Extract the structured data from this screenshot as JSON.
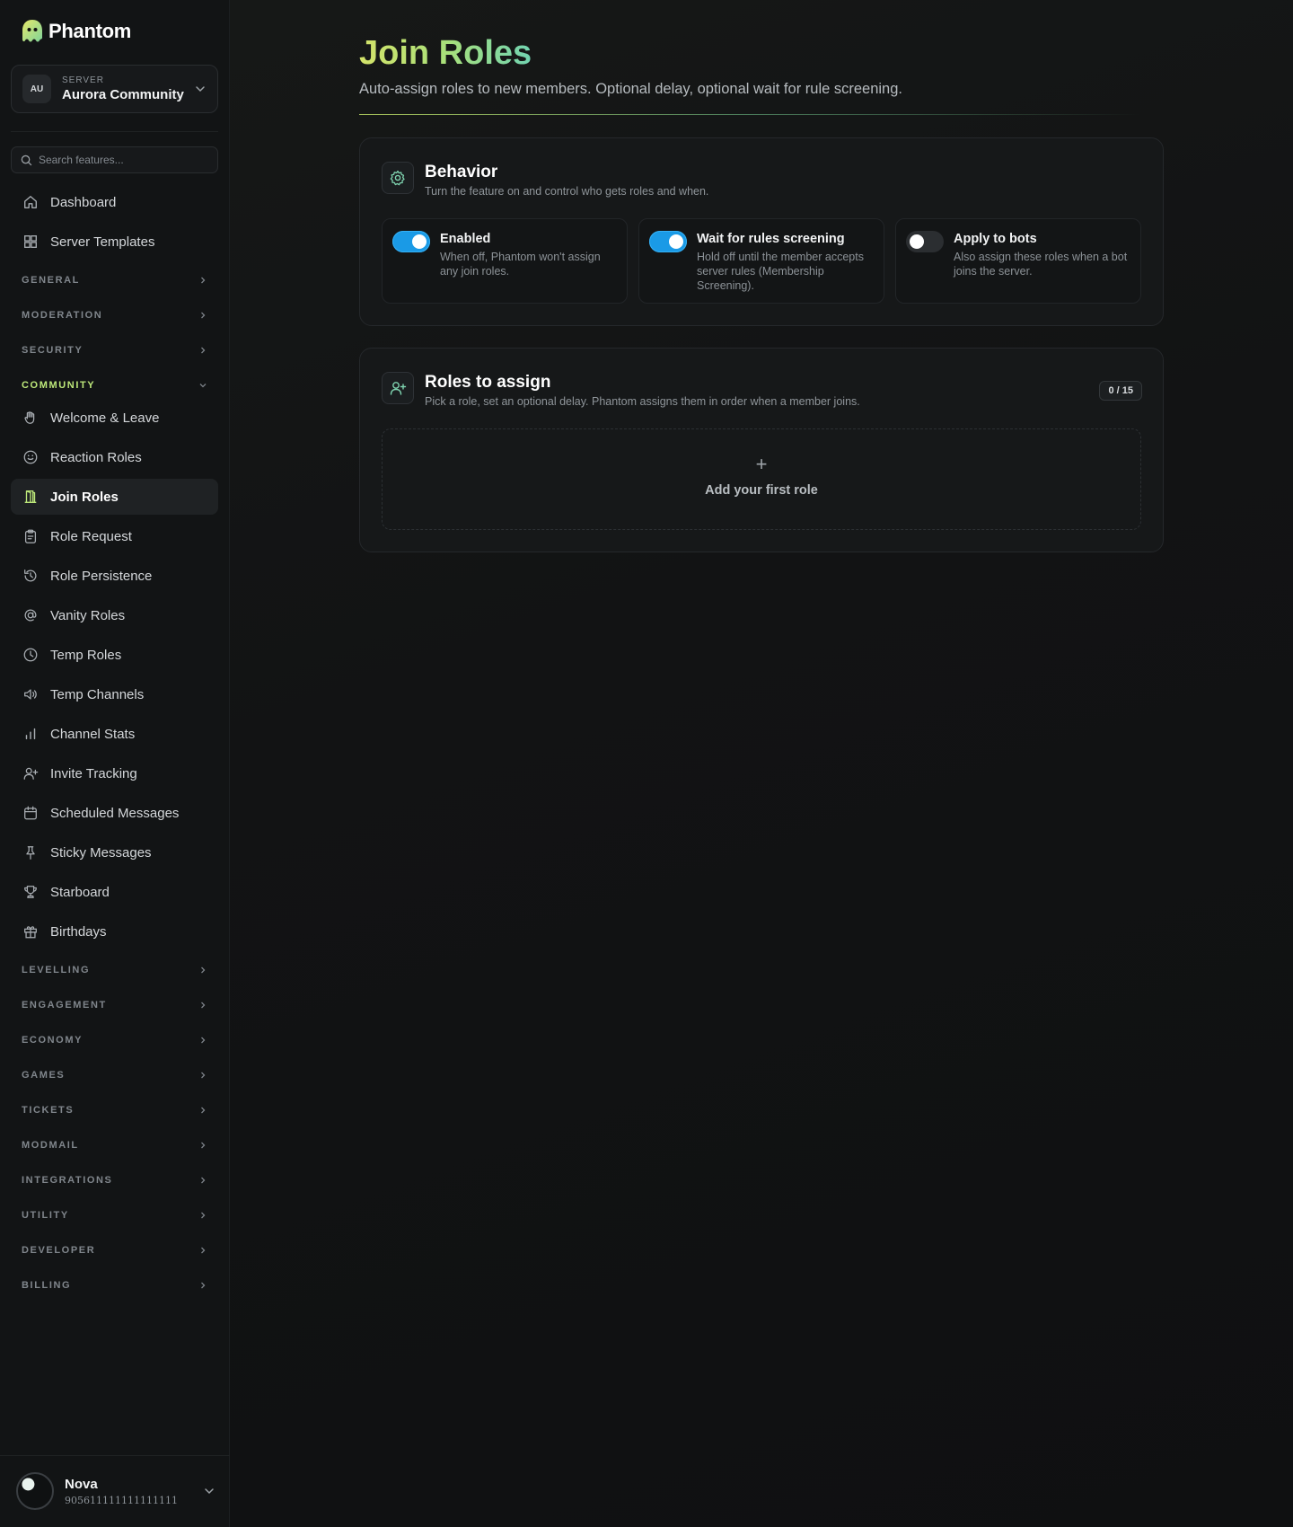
{
  "brand": {
    "name": "Phantom"
  },
  "server": {
    "avatar": "AU",
    "caption": "SERVER",
    "name": "Aurora Community"
  },
  "search": {
    "placeholder": "Search features..."
  },
  "nav_top": [
    {
      "label": "Dashboard",
      "icon": "home-icon"
    },
    {
      "label": "Server Templates",
      "icon": "grid-icon"
    }
  ],
  "sections": {
    "general": "GENERAL",
    "moderation": "MODERATION",
    "security": "SECURITY",
    "community": "COMMUNITY",
    "levelling": "LEVELLING",
    "engagement": "ENGAGEMENT",
    "economy": "ECONOMY",
    "games": "GAMES",
    "tickets": "TICKETS",
    "modmail": "MODMAIL",
    "integrations": "INTEGRATIONS",
    "utility": "UTILITY",
    "developer": "DEVELOPER",
    "billing": "BILLING"
  },
  "community_items": [
    {
      "label": "Welcome & Leave",
      "icon": "hand-icon"
    },
    {
      "label": "Reaction Roles",
      "icon": "smile-icon"
    },
    {
      "label": "Join Roles",
      "icon": "door-icon",
      "active": true
    },
    {
      "label": "Role Request",
      "icon": "clipboard-icon"
    },
    {
      "label": "Role Persistence",
      "icon": "history-icon"
    },
    {
      "label": "Vanity Roles",
      "icon": "at-icon"
    },
    {
      "label": "Temp Roles",
      "icon": "clock-icon"
    },
    {
      "label": "Temp Channels",
      "icon": "speaker-icon"
    },
    {
      "label": "Channel Stats",
      "icon": "bar-chart-icon"
    },
    {
      "label": "Invite Tracking",
      "icon": "user-plus-icon"
    },
    {
      "label": "Scheduled Messages",
      "icon": "calendar-icon"
    },
    {
      "label": "Sticky Messages",
      "icon": "pin-icon"
    },
    {
      "label": "Starboard",
      "icon": "trophy-icon"
    },
    {
      "label": "Birthdays",
      "icon": "gift-icon"
    }
  ],
  "user": {
    "name": "Nova",
    "id": "905611111111111111"
  },
  "page": {
    "title": "Join Roles",
    "subtitle": "Auto-assign roles to new members. Optional delay, optional wait for rule screening."
  },
  "behavior": {
    "title": "Behavior",
    "description": "Turn the feature on and control who gets roles and when.",
    "toggles": [
      {
        "title": "Enabled",
        "description": "When off, Phantom won't assign any join roles.",
        "on": true
      },
      {
        "title": "Wait for rules screening",
        "description": "Hold off until the member accepts server rules (Membership Screening).",
        "on": true
      },
      {
        "title": "Apply to bots",
        "description": "Also assign these roles when a bot joins the server.",
        "on": false
      }
    ]
  },
  "roles": {
    "title": "Roles to assign",
    "description": "Pick a role, set an optional delay. Phantom assigns them in order when a member joins.",
    "count": "0 / 15",
    "add_symbol": "+",
    "add_label": "Add your first role"
  },
  "colors": {
    "accent_green": "#bde87a",
    "toggle_on": "#1a9ae6",
    "background": "#111213"
  }
}
